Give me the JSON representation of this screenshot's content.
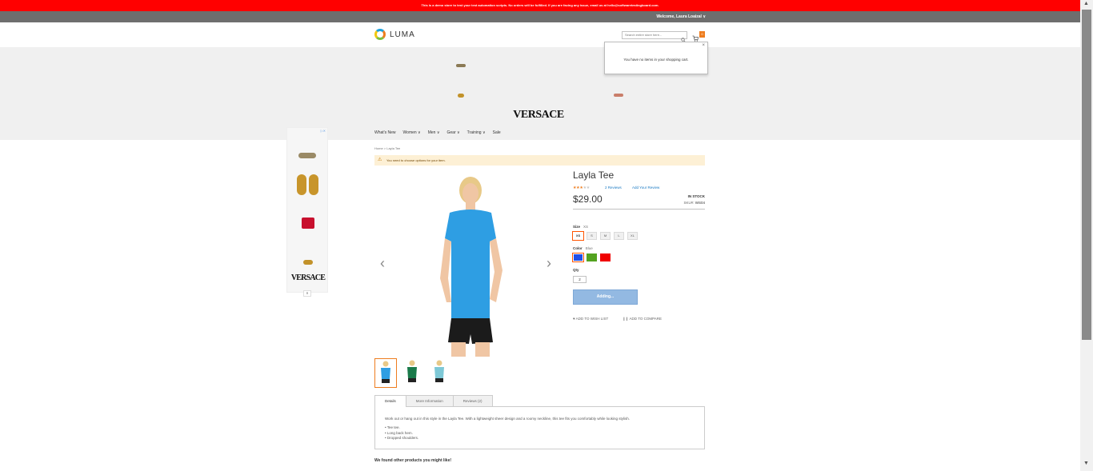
{
  "top_bars": {
    "demo_notice": "This is a demo store to test your test automation scripts. No orders will be fulfilled. If you are facing any issue, email us at hello@softwaretestingboard.com.",
    "welcome": "Welcome, Laura Loaizal ∨"
  },
  "header": {
    "logo_text": "LUMA",
    "search_placeholder": "Search entire store here...",
    "cart_count": "0"
  },
  "minicart": {
    "close": "×",
    "empty_message": "You have no items in your shopping cart."
  },
  "banner": {
    "brand": "VERSACE"
  },
  "nav": {
    "items": [
      "What's New",
      "Women ∨",
      "Men ∨",
      "Gear ∨",
      "Training ∨",
      "Sale"
    ]
  },
  "side_ad": {
    "brand": "VERSACE",
    "collapse": "∧",
    "adchoices": "▷✕"
  },
  "breadcrumb": "Home  >  Layla Tee",
  "notice": "You need to choose options for your item.",
  "product": {
    "name": "Layla Tee",
    "rating_percent": 60,
    "reviews_label": "2  Reviews",
    "add_review_label": "Add Your Review",
    "price": "$29.00",
    "stock": "IN STOCK",
    "sku_label": "SKU#:",
    "sku": "WS04",
    "size_label": "Size",
    "size_value": "XS",
    "sizes": [
      "XS",
      "S",
      "M",
      "L",
      "XL"
    ],
    "color_label": "Color",
    "color_value": "Blue",
    "colors": [
      "#1f4fe8",
      "#53a220",
      "#f00000"
    ],
    "qty_label": "Qty",
    "qty": "2",
    "add_button": "Adding...",
    "wishlist": "♥  ADD TO WISH LIST",
    "compare": "❙❙ ADD TO COMPARE",
    "shirt_colors": [
      "#2e9ee3",
      "#1a7a4a",
      "#7ec8d6"
    ]
  },
  "tabs": {
    "items": [
      "Details",
      "More Information",
      "Reviews (2)"
    ],
    "description": "Work out or hang out in this style in the Layla Tee. With a lightweight sheer design and a roomy neckline, this tee fits you comfortably while looking stylish.",
    "bullets": [
      "• Tee tee.",
      "• Long back hem.",
      "• Dropped shoulders."
    ]
  },
  "related_heading": "We found other products you might like!",
  "colors": {
    "accent": "#ee7d1f",
    "demo_bar": "#ff0000",
    "link": "#1979c3"
  }
}
